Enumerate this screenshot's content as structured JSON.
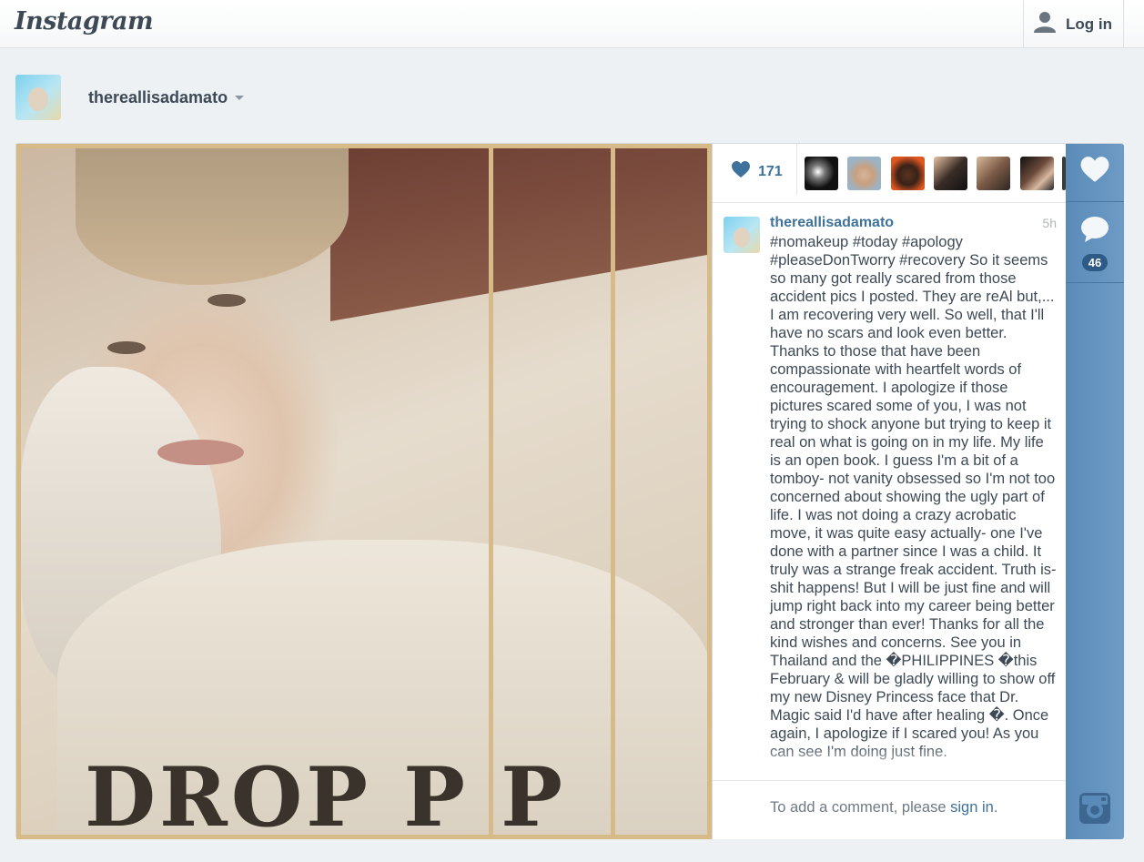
{
  "header": {
    "logo_text": "Instagram",
    "login_label": "Log in"
  },
  "profile": {
    "username": "thereallisadamato"
  },
  "post": {
    "like_count": "171",
    "comment_count": "46",
    "caption_user": "thereallisadamato",
    "time_ago": "5h",
    "caption": "#nomakeup #today #apology #pleaseDonTworry #recovery So it seems so many got really scared from those accident pics I posted. They are reAl but,... I am recovering very well. So well, that I'll have no scars and look even better. Thanks to those that have been compassionate with heartfelt words of encouragement. I apologize if those pictures scared some of you, I was not trying to shock anyone but trying to keep it real on what is going on in my life. My life is an open book. I guess I'm a bit of a tomboy- not vanity obsessed so I'm not too concerned about showing the ugly part of life. I was not doing a crazy acrobatic move, it was quite easy actually- one I've done with a partner since I was a child. It truly was a strange freak accident. Truth is- shit happens! But I will be just fine and will jump right back into my career being better and stronger than ever! Thanks for all the kind wishes and concerns. See you in Thailand and the �PHILIPPINES �this February & will be gladly willing to show off my new Disney Princess face that Dr. Magic said I'd have after healing �. Once again, I apologize if I scared you! As you can see I'm doing just fine.",
    "comment_prompt": "To add a comment, please ",
    "sign_in_label": "sign in",
    "comment_suffix": ".",
    "photo_shirt_text": "DROP  P  P"
  },
  "icons": {
    "user": "user-icon",
    "heart": "heart-icon",
    "comment": "comment-icon",
    "camera": "camera-icon"
  },
  "colors": {
    "accent": "#3f729b",
    "sidebar": "#6e9bc6",
    "background": "#eef1f4"
  }
}
